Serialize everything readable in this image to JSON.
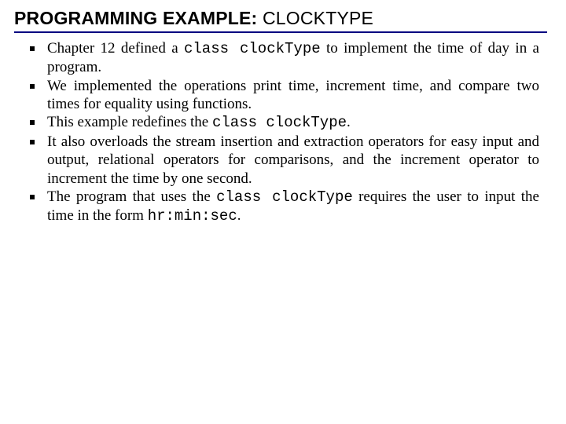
{
  "title": {
    "bold": "PROGRAMMING EXAMPLE: ",
    "plain": "CLOCKTYPE"
  },
  "bullets": [
    {
      "pre": "Chapter 12 defined a ",
      "code": "class clockType",
      "post": " to implement the time of day in a program."
    },
    {
      "pre": "We implemented the operations print time, increment time, and compare two times for equality using functions.",
      "code": "",
      "post": ""
    },
    {
      "pre": "This example redefines the ",
      "code": "class clockType",
      "post": "."
    },
    {
      "pre": "It also overloads the stream insertion and extraction operators for easy input and output, relational operators for comparisons, and the increment operator to increment the time by one second.",
      "code": "",
      "post": ""
    },
    {
      "pre": "The program that uses the ",
      "code": "class clockType",
      "post": " requires the user to input the time in the form ",
      "code2": "hr:min:sec",
      "post2": "."
    }
  ]
}
